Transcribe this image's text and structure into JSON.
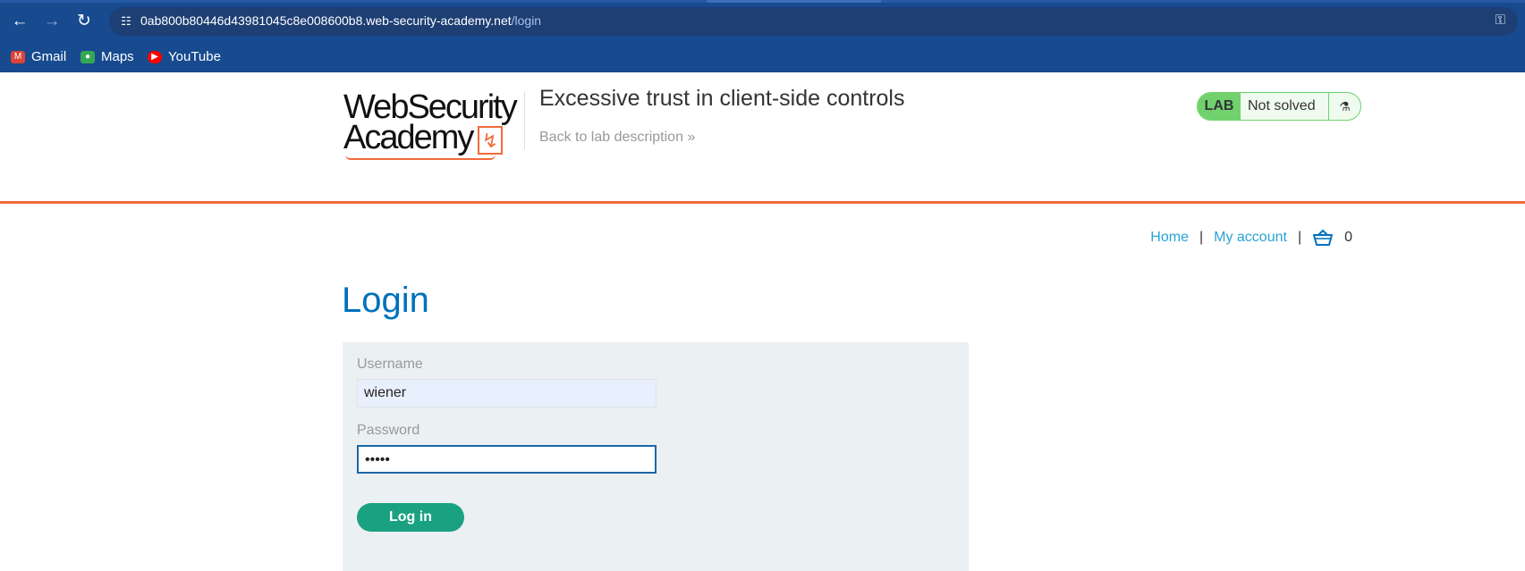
{
  "browser": {
    "url_host": "0ab800b80446d43981045c8e008600b8.web-security-academy.net",
    "url_path": "/login",
    "bookmarks": [
      {
        "label": "Gmail",
        "icon": "gmail-icon",
        "color": "#db4437"
      },
      {
        "label": "Maps",
        "icon": "maps-icon",
        "color": "#34a853"
      },
      {
        "label": "YouTube",
        "icon": "youtube-icon",
        "color": "#ff0000"
      }
    ]
  },
  "header": {
    "logo_line1": "WebSecurity",
    "logo_line2": "Academy",
    "lab_title": "Excessive trust in client-side controls",
    "back_link": "Back to lab description",
    "status_tag": "LAB",
    "status_text": "Not solved",
    "accent_color": "#f06a3a"
  },
  "nav": {
    "home": "Home",
    "separator": "|",
    "my_account": "My account",
    "cart_count": "0"
  },
  "login": {
    "heading": "Login",
    "username_label": "Username",
    "username_value": "wiener",
    "password_label": "Password",
    "password_value": "•••••",
    "submit_label": "Log in"
  }
}
